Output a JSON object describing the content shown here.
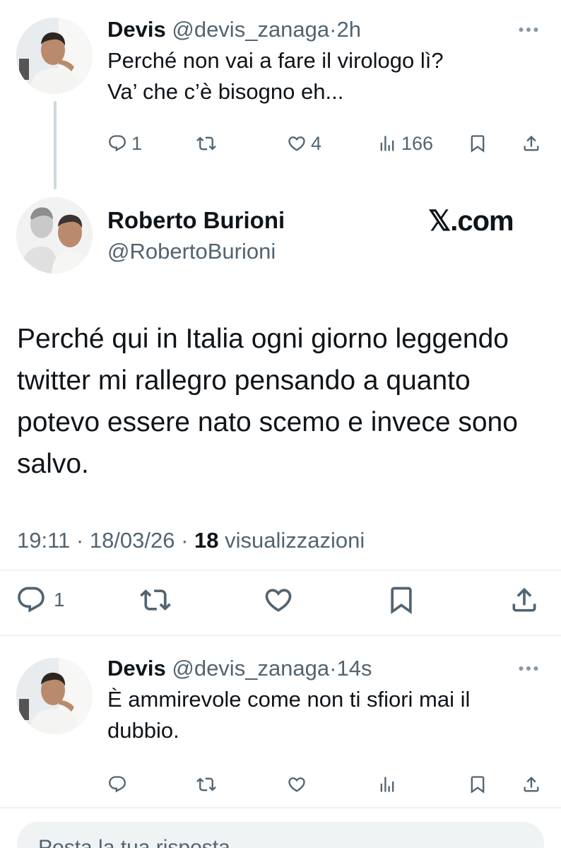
{
  "reply1": {
    "name": "Devis",
    "handle": "@devis_zanaga",
    "dot": "·",
    "time": "2h",
    "text": "Perché non vai a fare il virologo lì?\nVa’ che c’è bisogno eh...",
    "reply_count": "1",
    "retweet_count": "",
    "like_count": "4",
    "view_count": "166"
  },
  "main_tweet": {
    "name": "Roberto Burioni",
    "handle": "@RobertoBurioni",
    "watermark": "𝕏.com",
    "text": "Perché qui in Italia ogni giorno leggendo twitter mi rallegro pensando a quanto potevo essere nato scemo e invece sono salvo.",
    "time": "19:11 · 18/03/26 · ",
    "views_number": "18",
    "views_label": " visualizzazioni",
    "reply_count": "1"
  },
  "reply2": {
    "name": "Devis",
    "handle": "@devis_zanaga",
    "dot": "·",
    "time": "14s",
    "text": "È ammirevole come non ti sfiori mai il dubbio."
  },
  "compose": {
    "placeholder": "Posta la tua risposta"
  },
  "icons": {
    "reply": "speech-bubble-icon",
    "retweet": "repost-icon",
    "like": "heart-icon",
    "views": "bar-chart-icon",
    "bookmark": "bookmark-icon",
    "share": "share-upload-icon",
    "more": "ellipsis-icon"
  },
  "colors": {
    "text": "#0f1419",
    "secondary": "#536471",
    "divider": "#eff3f4",
    "thread_line": "#cfd9de"
  }
}
